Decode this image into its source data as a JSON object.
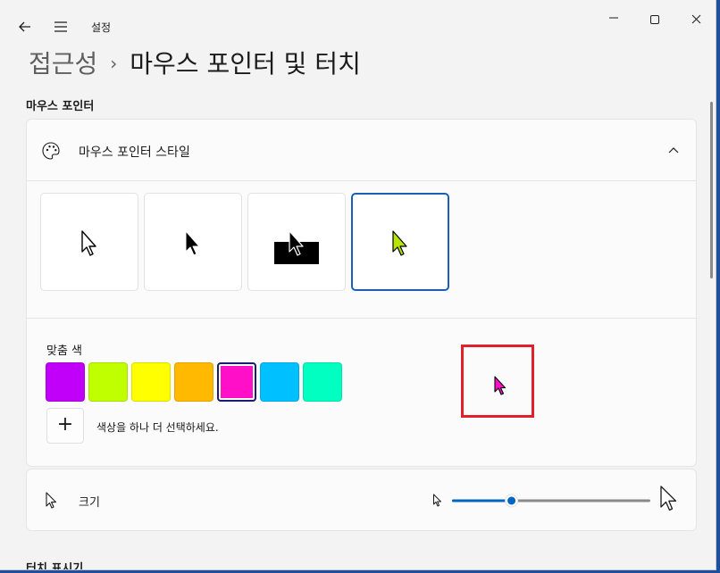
{
  "window": {
    "title": "설정"
  },
  "breadcrumb": {
    "parent": "접근성",
    "separator": "›",
    "current": "마우스 포인터 및 터치"
  },
  "section_title": "마우스 포인터",
  "style_card": {
    "label": "마우스 포인터 스타일",
    "options": [
      "white",
      "black",
      "inverted",
      "custom"
    ],
    "selected_option": "custom",
    "custom_color_label": "맞춤 색",
    "swatches": [
      "#c000f8",
      "#c0ff00",
      "#ffff00",
      "#ffb900",
      "#ff10c8",
      "#00c0ff",
      "#00ffc0"
    ],
    "selected_swatch": "#ff10c8",
    "add_label": "+",
    "add_text": "색상을 하나 더 선택하세요.",
    "preview_color": "#ff10c8",
    "highlight_color": "#e0202a"
  },
  "size_card": {
    "label": "크기",
    "value": 0.3
  },
  "next_section_title": "터치 표시기",
  "icons": {
    "back": "back-arrow-icon",
    "menu": "hamburger-icon",
    "minimize": "minimize-icon",
    "maximize": "maximize-icon",
    "close": "close-icon",
    "palette": "palette-icon",
    "collapse": "chevron-up-icon",
    "size": "cursor-icon"
  },
  "accent_color": "#0067c0"
}
